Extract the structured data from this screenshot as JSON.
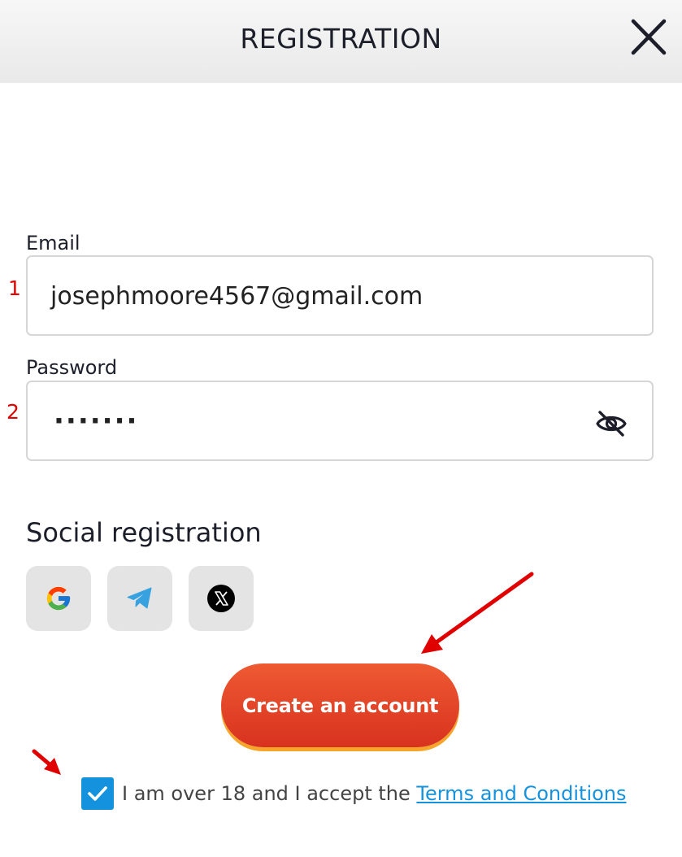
{
  "header": {
    "title": "REGISTRATION",
    "close_icon": "close-icon"
  },
  "form": {
    "email": {
      "label": "Email",
      "value": "josephmoore4567@gmail.com",
      "marker": "1"
    },
    "password": {
      "label": "Password",
      "masked_value": "·······",
      "marker": "2",
      "toggle_icon": "eye-slash-icon"
    }
  },
  "social": {
    "title": "Social registration",
    "buttons": [
      {
        "icon": "google-icon"
      },
      {
        "icon": "telegram-icon"
      },
      {
        "icon": "x-icon"
      }
    ]
  },
  "submit": {
    "label": "Create an account"
  },
  "terms": {
    "checked": true,
    "text": "I am over 18 and I accept the ",
    "link_text": "Terms and Conditions"
  },
  "colors": {
    "accent_blue": "#1592de",
    "button_top": "#ee5a32",
    "button_bottom": "#d8321f",
    "annotation_red": "#e00000"
  }
}
